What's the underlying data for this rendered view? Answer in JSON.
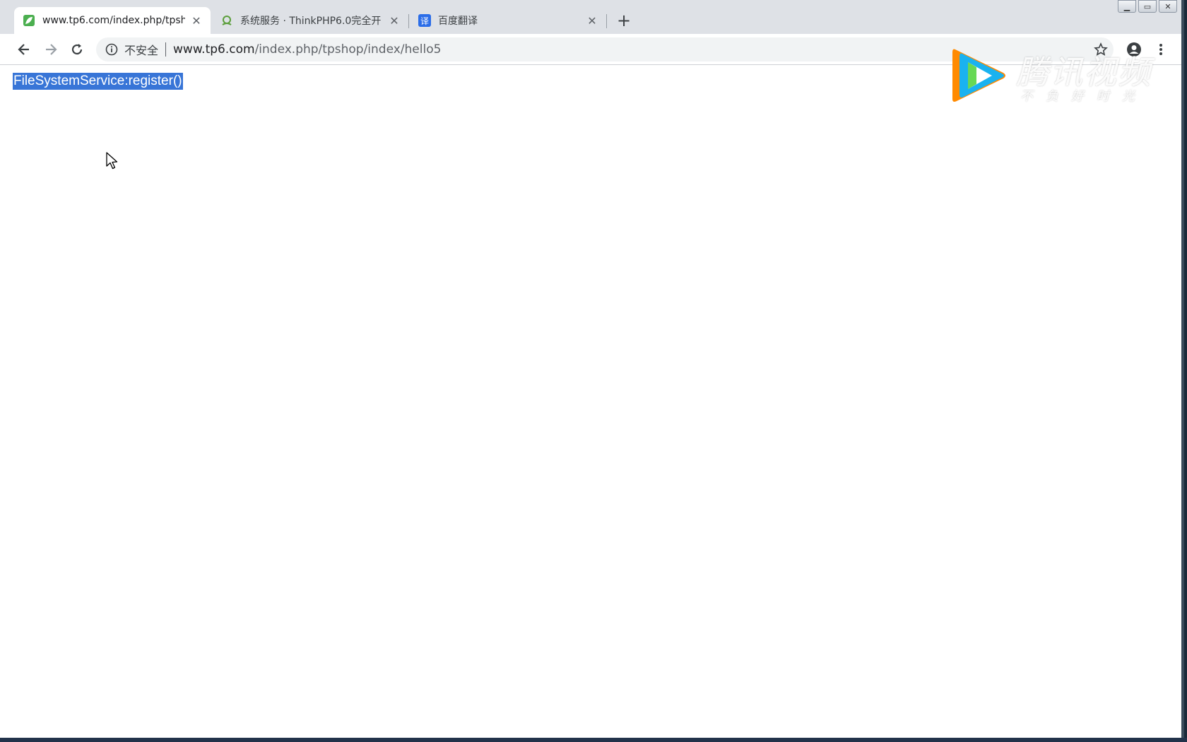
{
  "tabs": [
    {
      "title": "www.tp6.com/index.php/tpshc",
      "active": true
    },
    {
      "title": "系统服务 · ThinkPHP6.0完全开",
      "active": false
    },
    {
      "title": "百度翻译",
      "active": false
    }
  ],
  "toolbar": {
    "security_label": "不安全",
    "url_host": "www.tp6.com",
    "url_path": "/index.php/tpshop/index/hello5"
  },
  "page": {
    "output_text": "FileSystemService:register()"
  },
  "watermark": {
    "brand": "腾讯视频",
    "slogan": "不负好时光"
  },
  "colors": {
    "selection": "#3875d7",
    "tabstrip": "#dee1e6"
  }
}
